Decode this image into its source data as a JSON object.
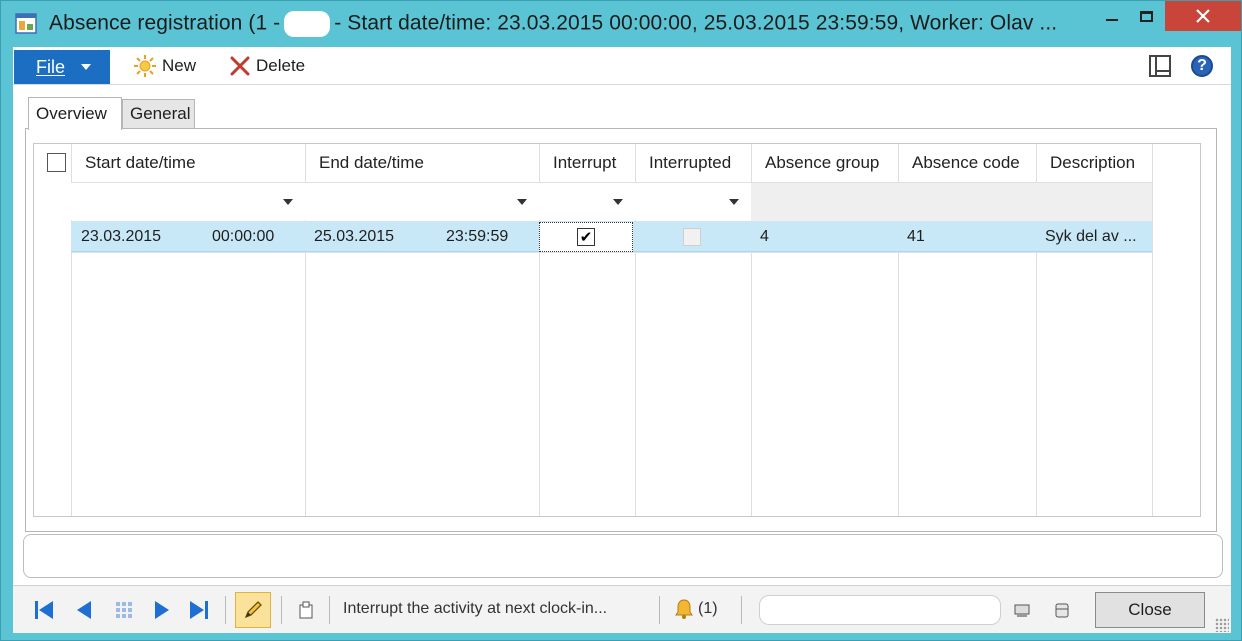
{
  "window": {
    "title_prefix": "Absence registration (1 -",
    "title_suffix": "- Start date/time: 23.03.2015 00:00:00, 25.03.2015 23:59:59, Worker: Olav ..."
  },
  "ribbon": {
    "file_label": "File",
    "new_label": "New",
    "delete_label": "Delete"
  },
  "tabs": [
    {
      "label": "Overview",
      "active": true
    },
    {
      "label": "General",
      "active": false
    }
  ],
  "grid": {
    "columns": [
      "Start date/time",
      "End date/time",
      "Interrupt",
      "Interrupted",
      "Absence group",
      "Absence code",
      "Description"
    ],
    "rows": [
      {
        "start_date": "23.03.2015",
        "start_time": "00:00:00",
        "end_date": "25.03.2015",
        "end_time": "23:59:59",
        "interrupt": true,
        "interrupted": false,
        "absence_group": "4",
        "absence_code": "41",
        "description": "Syk del av ..."
      }
    ]
  },
  "statusbar": {
    "message": "Interrupt the activity at next clock-in...",
    "notifications": "(1)",
    "close_label": "Close"
  },
  "colors": {
    "frame": "#5bc4d4",
    "file_button": "#1b6ec2",
    "selected_row": "#c9e8f7",
    "close_window": "#c9453a",
    "edit_button": "#fbe29a"
  }
}
